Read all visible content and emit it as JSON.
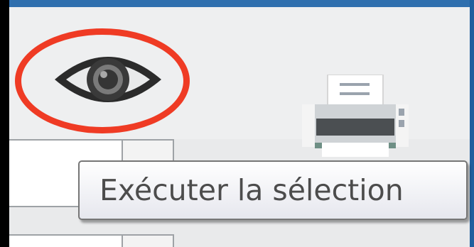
{
  "toolbar": {
    "view_icon": "eye-icon",
    "print_icon": "printer-icon",
    "highlight_color": "#ef3b24"
  },
  "tooltip": {
    "text": "Exécuter la sélection"
  }
}
